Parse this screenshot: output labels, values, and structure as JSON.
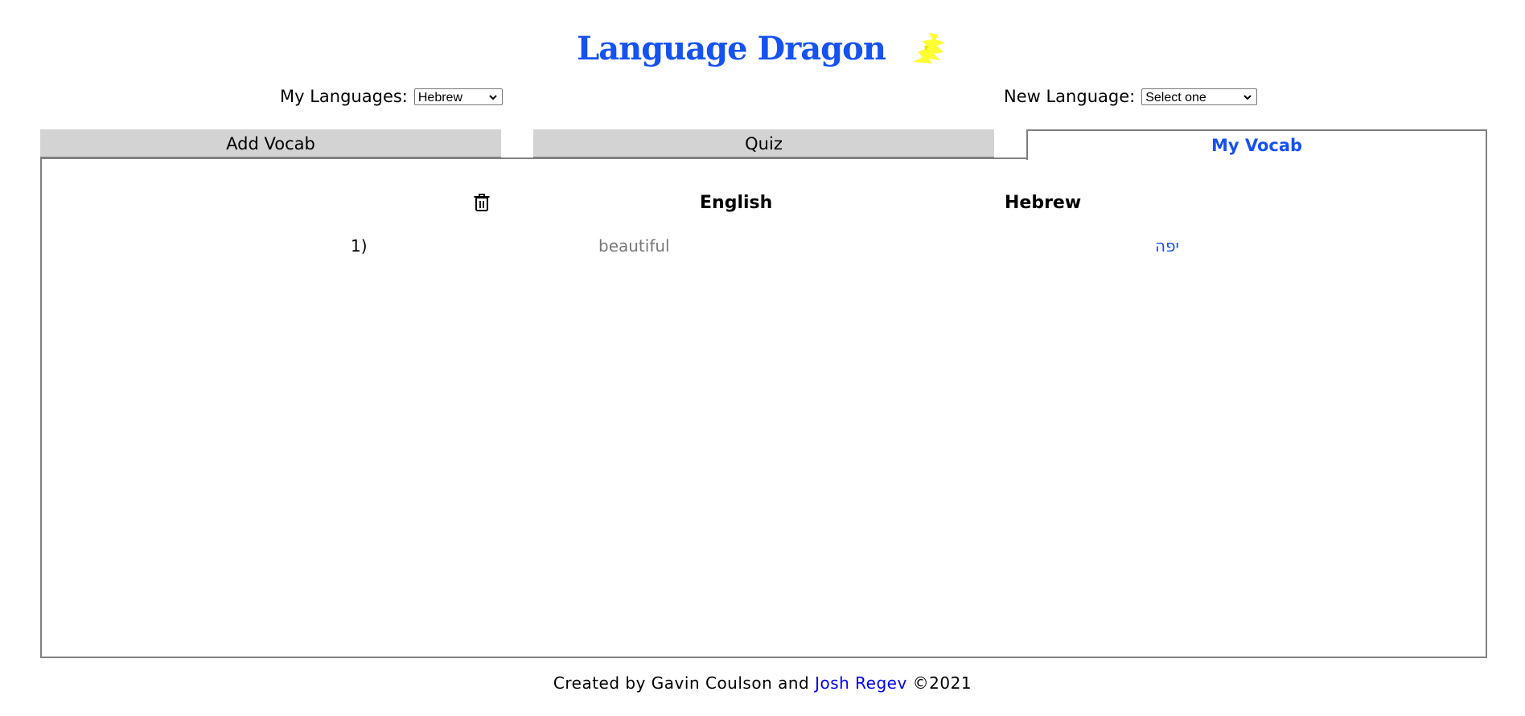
{
  "header": {
    "title": "Language Dragon",
    "logo_icon": "dragon-icon",
    "title_color": "#1652f0",
    "logo_color": "#ffff33"
  },
  "languages": {
    "my_label": "My Languages:",
    "my_selected": "Hebrew",
    "new_label": "New Language:",
    "new_selected": "Select one"
  },
  "tabs": [
    {
      "label": "Add Vocab",
      "active": false
    },
    {
      "label": "Quiz",
      "active": false
    },
    {
      "label": "My Vocab",
      "active": true
    }
  ],
  "vocab": {
    "delete_icon": "trash-icon",
    "col_english": "English",
    "col_target": "Hebrew",
    "rows": [
      {
        "num": "1)",
        "english": "beautiful",
        "translation": "יפה"
      }
    ]
  },
  "footer": {
    "prefix": "Created by Gavin Coulson and ",
    "link": "Josh Regev",
    "suffix": " ©2021"
  }
}
